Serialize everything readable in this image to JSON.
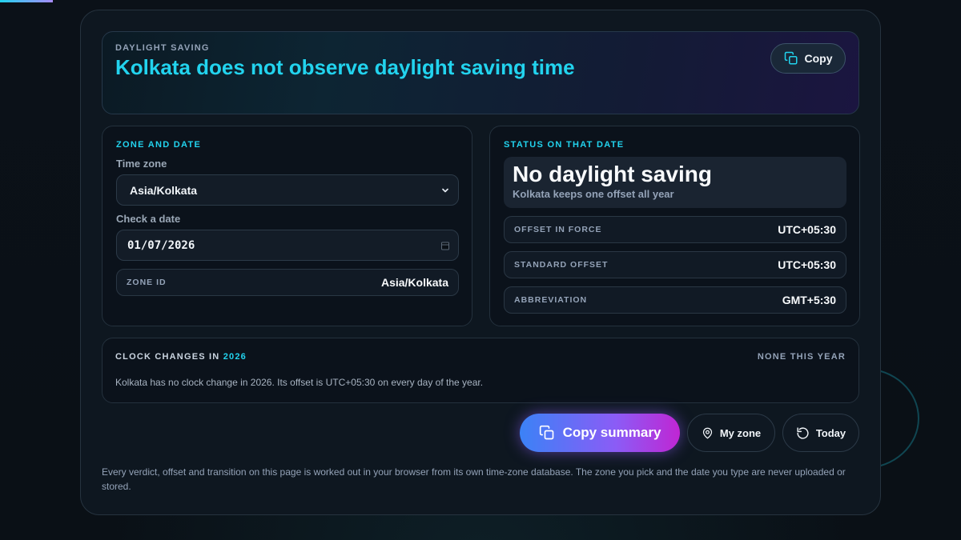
{
  "hero": {
    "eyebrow": "DAYLIGHT SAVING",
    "title": "Kolkata does not observe daylight saving time",
    "copy_label": "Copy"
  },
  "zone_panel": {
    "heading": "ZONE AND DATE",
    "timezone_label": "Time zone",
    "timezone_value": "Asia/Kolkata",
    "date_label": "Check a date",
    "date_value": "01/07/2026",
    "zone_id_key": "ZONE ID",
    "zone_id_value": "Asia/Kolkata"
  },
  "status_panel": {
    "heading": "STATUS ON THAT DATE",
    "verdict": "No daylight saving",
    "verdict_sub": "Kolkata keeps one offset all year",
    "rows": [
      {
        "key": "OFFSET IN FORCE",
        "value": "UTC+05:30"
      },
      {
        "key": "STANDARD OFFSET",
        "value": "UTC+05:30"
      },
      {
        "key": "ABBREVIATION",
        "value": "GMT+5:30"
      }
    ]
  },
  "clock_changes": {
    "heading": "CLOCK CHANGES IN",
    "year": "2026",
    "status": "NONE THIS YEAR",
    "body": "Kolkata has no clock change in 2026. Its offset is UTC+05:30 on every day of the year."
  },
  "actions": {
    "copy_summary": "Copy summary",
    "my_zone": "My zone",
    "today": "Today"
  },
  "footnote": "Every verdict, offset and transition on this page is worked out in your browser from its own time-zone database. The zone you pick and the date you type are never uploaded or stored.",
  "icons": {
    "copy": "copy-icon",
    "location": "map-pin-icon",
    "reset": "rotate-ccw-icon",
    "calendar": "calendar-icon",
    "dropdown": "chevron-down-icon"
  },
  "colors": {
    "accent": "#22d3ee",
    "gradient_start": "#3b82f6",
    "gradient_end": "#c026d3",
    "background": "#0a1016"
  }
}
